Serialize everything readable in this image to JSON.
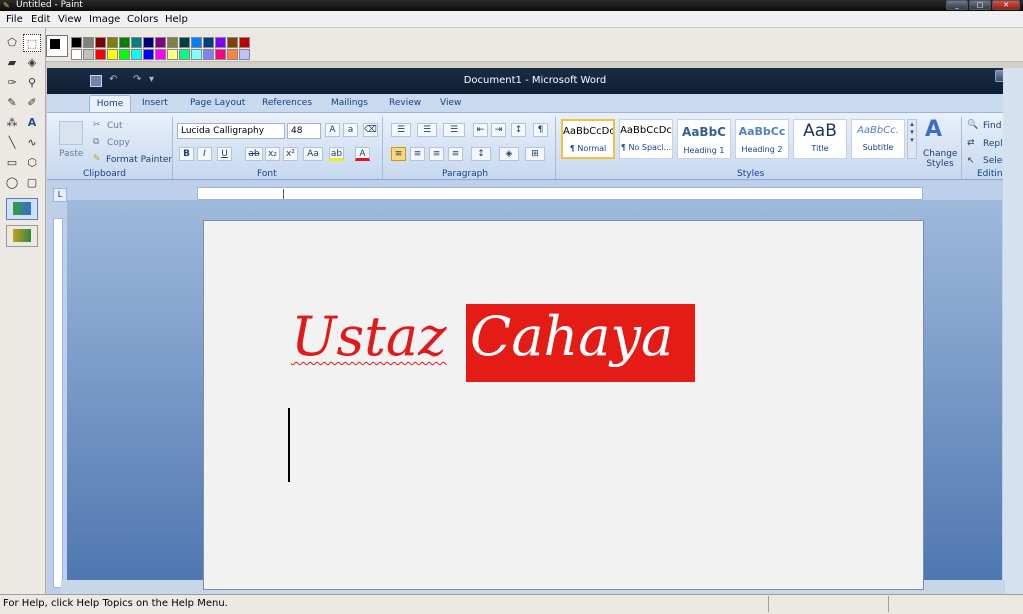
{
  "paint": {
    "title": "Untitled - Paint",
    "menu": [
      "File",
      "Edit",
      "View",
      "Image",
      "Colors",
      "Help"
    ],
    "palette_top": [
      "#000000",
      "#808080",
      "#800000",
      "#808000",
      "#008000",
      "#008080",
      "#000080",
      "#800080",
      "#808040",
      "#004040",
      "#0080ff",
      "#004080",
      "#8000ff",
      "#804000",
      "#c00000"
    ],
    "palette_bottom": [
      "#ffffff",
      "#c0c0c0",
      "#ff0000",
      "#ffff00",
      "#00ff00",
      "#00ffff",
      "#0000ff",
      "#ff00ff",
      "#ffff80",
      "#00ff80",
      "#80ffff",
      "#8080ff",
      "#ff0080",
      "#ff8040",
      "#c0c0ff"
    ],
    "status": "For Help, click Help Topics on the Help Menu.",
    "tools": [
      "free-select",
      "rect-select",
      "eraser",
      "fill",
      "picker",
      "magnifier",
      "pencil",
      "brush",
      "airbrush",
      "text",
      "line",
      "curve",
      "rectangle",
      "polygon",
      "ellipse",
      "rounded-rect"
    ],
    "window_buttons": [
      "_",
      "□",
      "✕"
    ]
  },
  "word": {
    "title": "Document1 - Microsoft Word",
    "tabs": [
      "Home",
      "Insert",
      "Page Layout",
      "References",
      "Mailings",
      "Review",
      "View"
    ],
    "clipboard": {
      "label": "Clipboard",
      "paste": "Paste",
      "cut": "Cut",
      "copy": "Copy",
      "format_painter": "Format Painter"
    },
    "font": {
      "label": "Font",
      "name": "Lucida Calligraphy",
      "size": "48"
    },
    "paragraph": {
      "label": "Paragraph"
    },
    "styles": {
      "label": "Styles",
      "items": [
        {
          "sample": "AaBbCcDc",
          "name": "¶ Normal"
        },
        {
          "sample": "AaBbCcDc",
          "name": "¶ No Spaci..."
        },
        {
          "sample": "AaBbC",
          "name": "Heading 1"
        },
        {
          "sample": "AaBbCc",
          "name": "Heading 2"
        },
        {
          "sample": "AaB",
          "name": "Title"
        },
        {
          "sample": "AaBbCc.",
          "name": "Subtitle"
        }
      ],
      "change_styles": "Change Styles"
    },
    "editing": {
      "label": "Editing",
      "find": "Find",
      "replace": "Repla",
      "select": "Select"
    },
    "document": {
      "word1": "Ustaz",
      "word2": "Cahaya"
    }
  }
}
